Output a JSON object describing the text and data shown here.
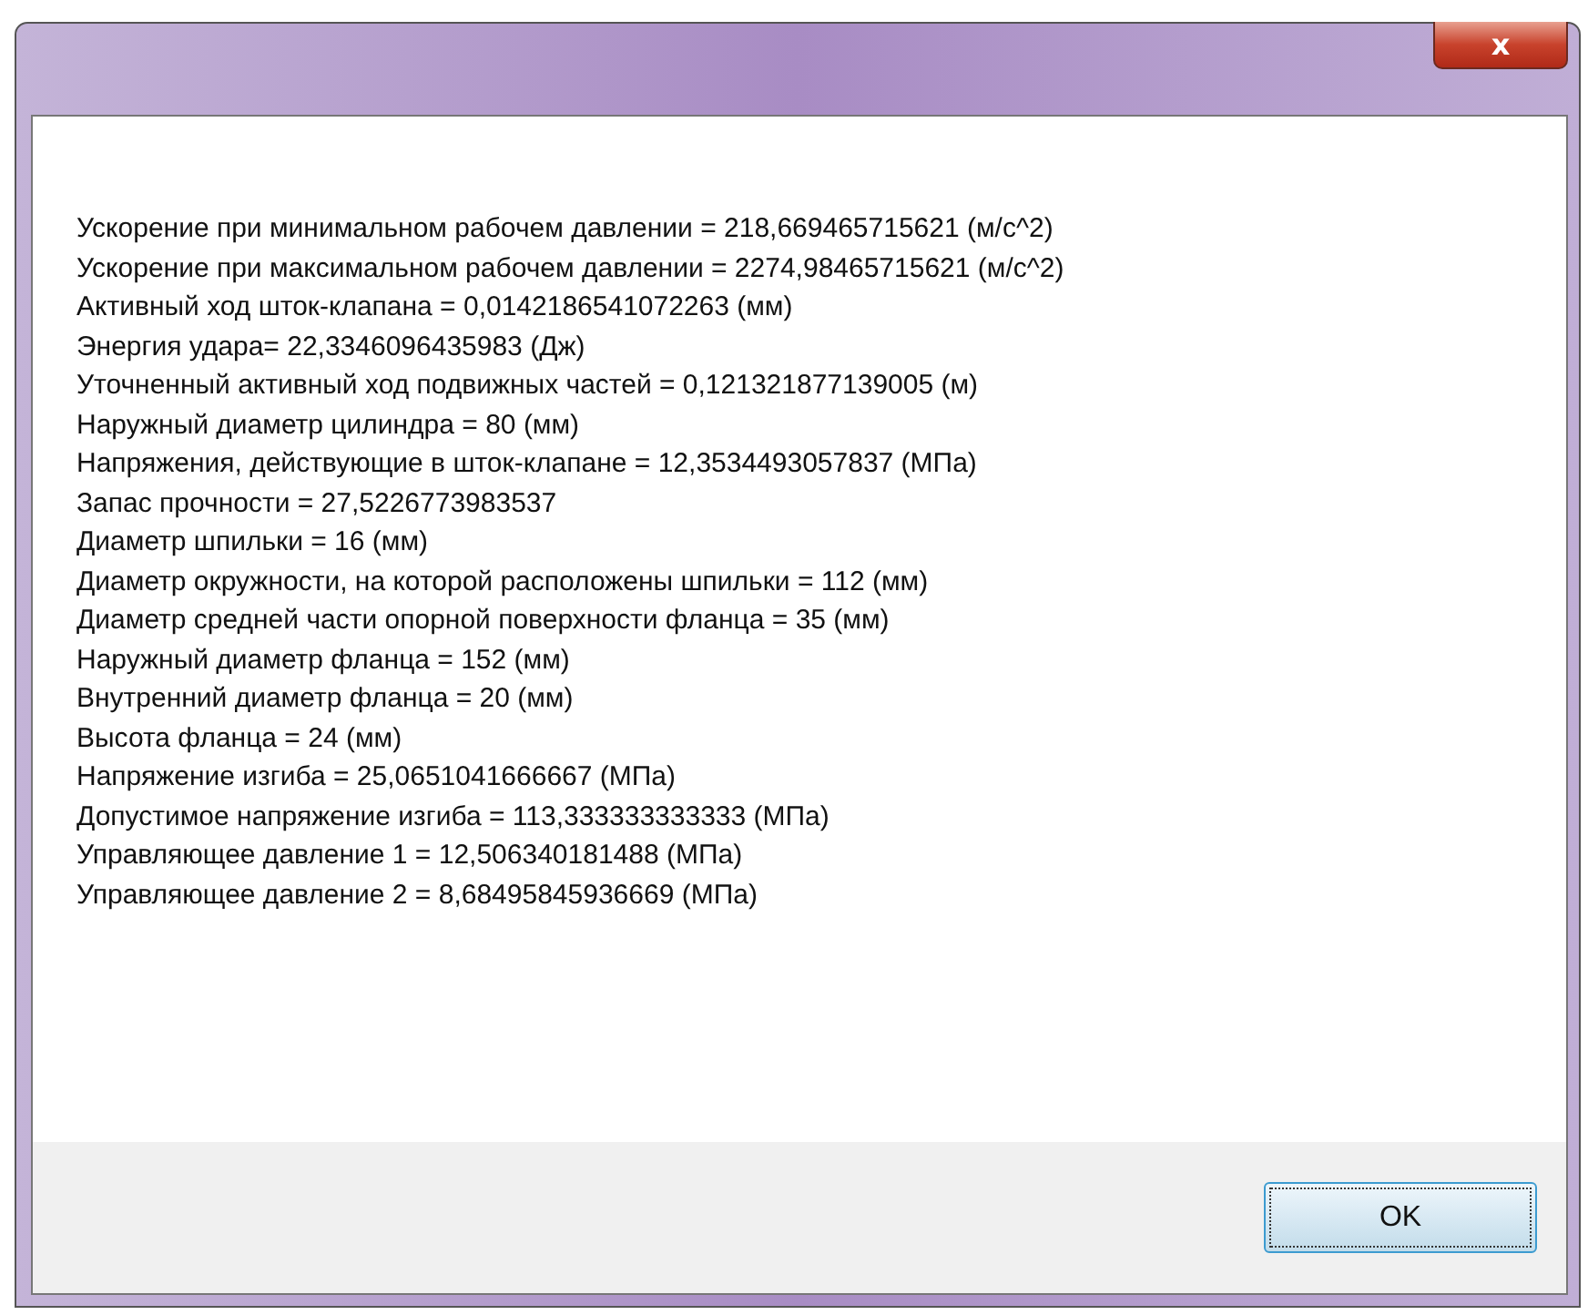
{
  "window": {
    "close_glyph": "x"
  },
  "lines": [
    "Ускорение при минимальном рабочем давлении = 218,669465715621 (м/с^2)",
    "Ускорение при максимальном рабочем давлении = 2274,98465715621 (м/с^2)",
    "Активный ход шток-клапана = 0,0142186541072263 (мм)",
    "Энергия удара= 22,3346096435983 (Дж)",
    "Уточненный активный ход подвижных частей  = 0,121321877139005 (м)",
    "Наружный диаметр цилиндра  = 80 (мм)",
    "Напряжения, действующие в шток-клапане = 12,3534493057837 (МПа)",
    "Запас прочности = 27,5226773983537",
    "Диаметр шпильки = 16 (мм)",
    "Диаметр окружности, на которой расположены шпильки = 112 (мм)",
    "Диаметр средней части опорной поверхности фланца = 35 (мм)",
    "Наружный диаметр фланца = 152 (мм)",
    "Внутренний диаметр фланца = 20 (мм)",
    "Высота фланца = 24 (мм)",
    "Напряжение изгиба = 25,0651041666667 (МПа)",
    "Допустимое напряжение изгиба = 113,333333333333 (МПа)",
    "Управляющее давление 1 = 12,506340181488 (МПа)",
    "Управляющее давление 2 = 8,68495845936669 (МПа)"
  ],
  "buttons": [
    "OK"
  ]
}
